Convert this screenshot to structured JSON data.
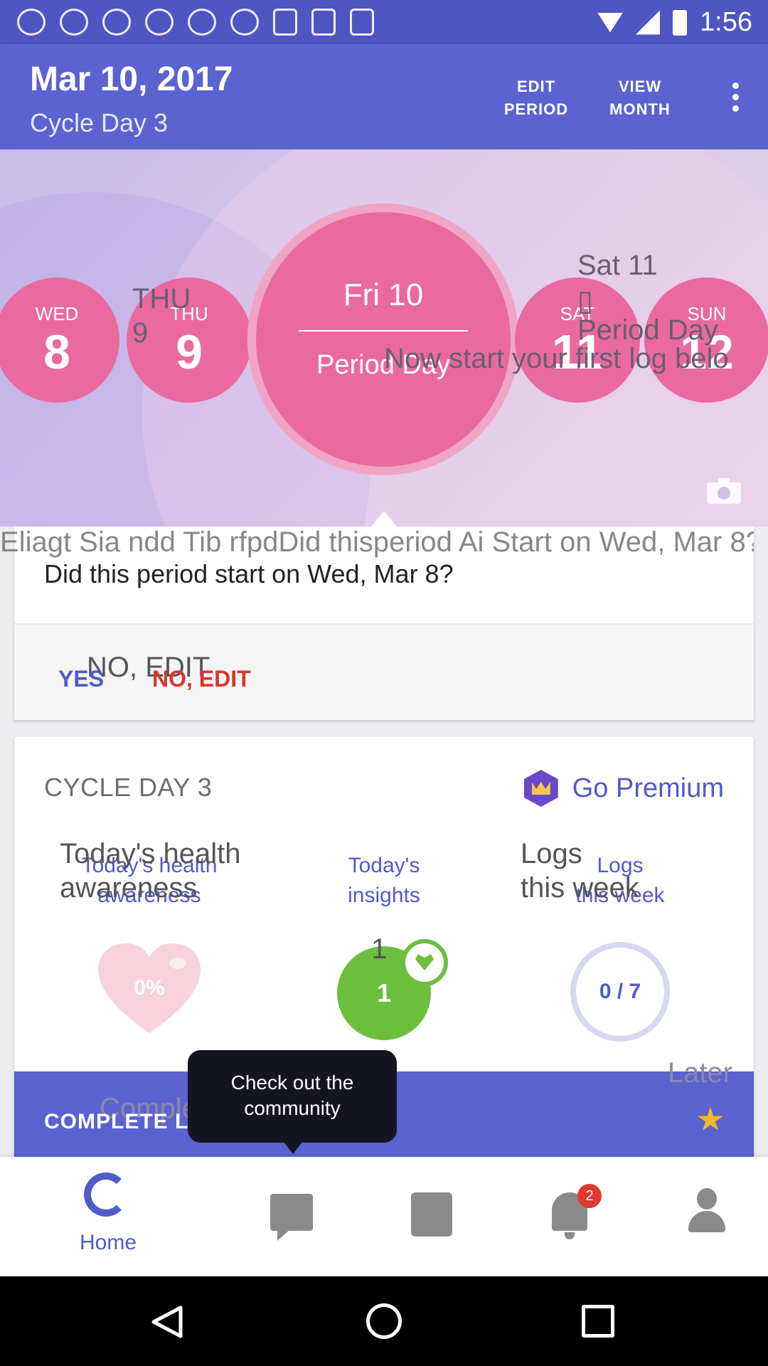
{
  "status_bar": {
    "time": "1:56"
  },
  "header": {
    "date": "Mar 10, 2017",
    "cycle_day": "Cycle Day 3",
    "edit_period": "EDIT\nPERIOD",
    "view_month": "VIEW\nMONTH"
  },
  "day_strip": {
    "days": [
      {
        "name": "WED",
        "num": "8"
      },
      {
        "name": "THU",
        "num": "9"
      },
      {
        "name": "SAT",
        "num": "11"
      },
      {
        "name": "SUN",
        "num": "12"
      }
    ],
    "selected": {
      "day": "Fri 10",
      "label": "Period Day"
    },
    "overlay": {
      "thu": "THU\n9",
      "sat": "Sat 11\n▯",
      "period_day": "Period Day",
      "log_hint": "Now start your first log belo"
    }
  },
  "period_card": {
    "question": "Did this period start on Wed, Mar 8?",
    "overlay": "Eliagt Sia ndd Tib rfpdDid thisperiod Ai Start on Wed, Mar 8?",
    "yes": "YES",
    "no_edit": "NO, EDIT",
    "no_edit_overlay": "NO, EDIT"
  },
  "cycle_card": {
    "title": "CYCLE DAY 3",
    "premium": "Go Premium",
    "stats": [
      {
        "label": "Today's health\nawareness",
        "overlay": "Today's health\nawareness",
        "value": "0%"
      },
      {
        "label": "Today's\ninsights",
        "value": "1",
        "overlay": "1"
      },
      {
        "label": "Logs\nthis week",
        "overlay": "Logs\nthis week",
        "value": "0 / 7"
      }
    ]
  },
  "complete_log": {
    "label": "COMPLETE LOG",
    "overlay": "Complete log",
    "later": "Later"
  },
  "tooltip": {
    "text": "Check out the\ncommunity"
  },
  "bottom_nav": {
    "home": "Home",
    "notification_count": "2"
  },
  "colors": {
    "primary": "#5a63d0",
    "pink": "#ea6aa0",
    "green": "#6cbf3d",
    "red": "#d6382e"
  }
}
